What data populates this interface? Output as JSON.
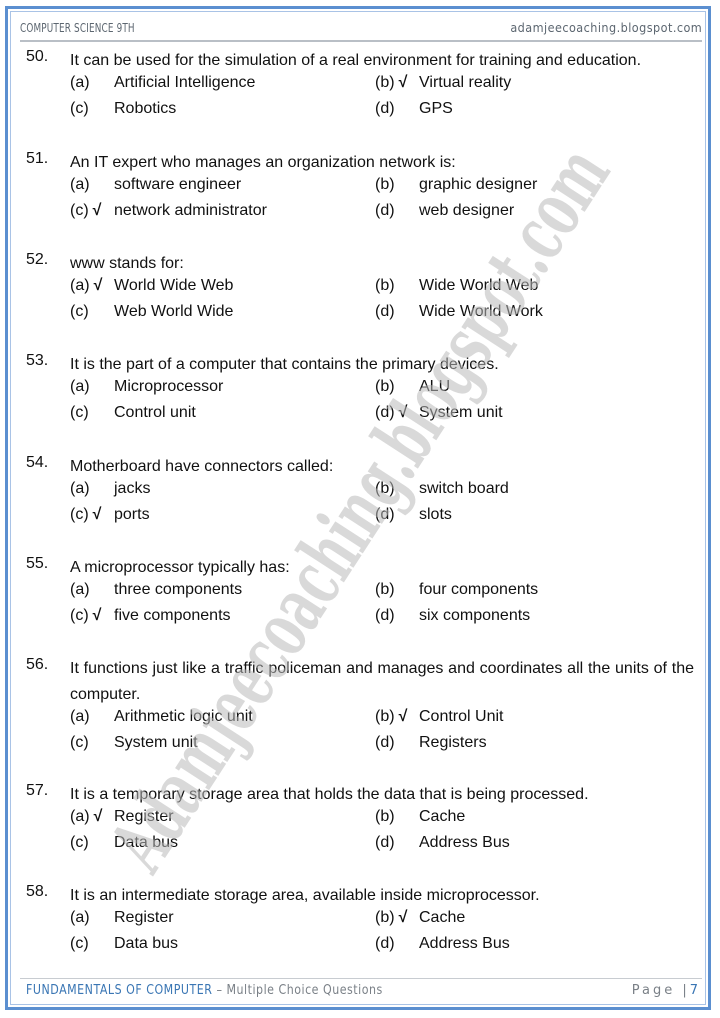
{
  "header": {
    "left": "COMPUTER SCIENCE 9TH",
    "right": "adamjeecoaching.blogspot.com"
  },
  "watermark": "Adamjeecoaching.blogspot.com",
  "check_icon": "√",
  "questions": [
    {
      "number": "50.",
      "text": "It can be used for the simulation of a real environment for training and education.",
      "options": [
        {
          "label": "(a)",
          "text": "Artificial Intelligence",
          "correct": false
        },
        {
          "label": "(b)",
          "text": "Virtual reality",
          "correct": true
        },
        {
          "label": "(c)",
          "text": "Robotics",
          "correct": false
        },
        {
          "label": "(d)",
          "text": "GPS",
          "correct": false
        }
      ]
    },
    {
      "number": "51.",
      "text": "An IT expert who manages an organization network is:",
      "options": [
        {
          "label": "(a)",
          "text": "software engineer",
          "correct": false
        },
        {
          "label": "(b)",
          "text": "graphic designer",
          "correct": false
        },
        {
          "label": "(c)",
          "text": "network administrator",
          "correct": true
        },
        {
          "label": "(d)",
          "text": "web designer",
          "correct": false
        }
      ]
    },
    {
      "number": "52.",
      "text": "www stands for:",
      "options": [
        {
          "label": "(a)",
          "text": "World Wide Web",
          "correct": true
        },
        {
          "label": "(b)",
          "text": "Wide World Web",
          "correct": false
        },
        {
          "label": "(c)",
          "text": "Web World Wide",
          "correct": false
        },
        {
          "label": "(d)",
          "text": "Wide World Work",
          "correct": false
        }
      ]
    },
    {
      "number": "53.",
      "text": "It is the part of a computer that contains the primary devices.",
      "options": [
        {
          "label": "(a)",
          "text": "Microprocessor",
          "correct": false
        },
        {
          "label": "(b)",
          "text": "ALU",
          "correct": false
        },
        {
          "label": "(c)",
          "text": "Control unit",
          "correct": false
        },
        {
          "label": "(d)",
          "text": "System unit",
          "correct": true
        }
      ]
    },
    {
      "number": "54.",
      "text": "Motherboard have connectors called:",
      "options": [
        {
          "label": "(a)",
          "text": "jacks",
          "correct": false
        },
        {
          "label": "(b)",
          "text": "switch board",
          "correct": false
        },
        {
          "label": "(c)",
          "text": "ports",
          "correct": true
        },
        {
          "label": "(d)",
          "text": "slots",
          "correct": false
        }
      ]
    },
    {
      "number": "55.",
      "text": "A microprocessor typically has:",
      "options": [
        {
          "label": "(a)",
          "text": "three components",
          "correct": false
        },
        {
          "label": "(b)",
          "text": "four components",
          "correct": false
        },
        {
          "label": "(c)",
          "text": "five components",
          "correct": true
        },
        {
          "label": "(d)",
          "text": "six components",
          "correct": false
        }
      ]
    },
    {
      "number": "56.",
      "text": "It functions just like a traffic policeman and manages and coordinates all the units of the computer.",
      "options": [
        {
          "label": "(a)",
          "text": "Arithmetic logic unit",
          "correct": false
        },
        {
          "label": "(b)",
          "text": "Control Unit",
          "correct": true
        },
        {
          "label": "(c)",
          "text": "System unit",
          "correct": false
        },
        {
          "label": "(d)",
          "text": "Registers",
          "correct": false
        }
      ]
    },
    {
      "number": "57.",
      "text": "It is a temporary storage area that holds the data that is being processed.",
      "options": [
        {
          "label": "(a)",
          "text": "Register",
          "correct": true
        },
        {
          "label": "(b)",
          "text": "Cache",
          "correct": false
        },
        {
          "label": "(c)",
          "text": "Data bus",
          "correct": false
        },
        {
          "label": "(d)",
          "text": "Address Bus",
          "correct": false
        }
      ]
    },
    {
      "number": "58.",
      "text": "It is an intermediate storage area, available inside microprocessor.",
      "options": [
        {
          "label": "(a)",
          "text": "Register",
          "correct": false
        },
        {
          "label": "(b)",
          "text": "Cache",
          "correct": true
        },
        {
          "label": "(c)",
          "text": "Data bus",
          "correct": false
        },
        {
          "label": "(d)",
          "text": "Address Bus",
          "correct": false
        }
      ]
    }
  ],
  "footer": {
    "title": "FUNDAMENTALS OF COMPUTER",
    "subtitle": " – Multiple Choice Questions",
    "page_label": "Page |",
    "page_number": "7"
  }
}
